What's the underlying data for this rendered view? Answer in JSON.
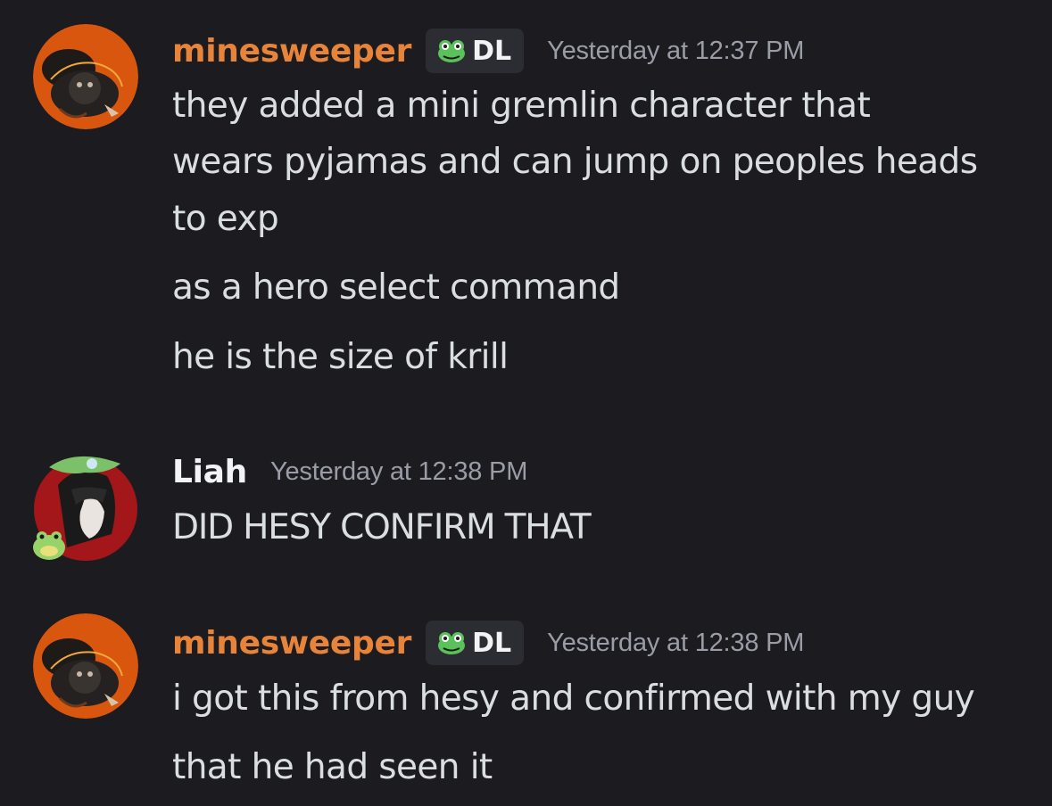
{
  "colors": {
    "background": "#1c1c20",
    "username_minesweeper": "#e8843a",
    "username_liah": "#f2f3f5",
    "timestamp": "#9a9ca6",
    "message_text": "#dbdee1",
    "tag_background": "#2c2d33"
  },
  "messages": [
    {
      "username": "minesweeper",
      "tag": {
        "icon": "frog-icon",
        "text": "DL"
      },
      "timestamp": "Yesterday at 12:37 PM",
      "avatar": "avatar-minesweeper",
      "lines": [
        "they added a mini gremlin character that",
        "wears pyjamas and can jump on peoples heads",
        "to exp",
        "as a hero select command",
        "he is the size of krill"
      ]
    },
    {
      "username": "Liah",
      "timestamp": "Yesterday at 12:38 PM",
      "avatar": "avatar-liah",
      "lines": [
        "DID HESY CONFIRM THAT"
      ]
    },
    {
      "username": "minesweeper",
      "tag": {
        "icon": "frog-icon",
        "text": "DL"
      },
      "timestamp": "Yesterday at 12:38 PM",
      "avatar": "avatar-minesweeper",
      "lines": [
        "i got this from hesy and confirmed with my guy",
        "that he had seen it"
      ]
    }
  ]
}
